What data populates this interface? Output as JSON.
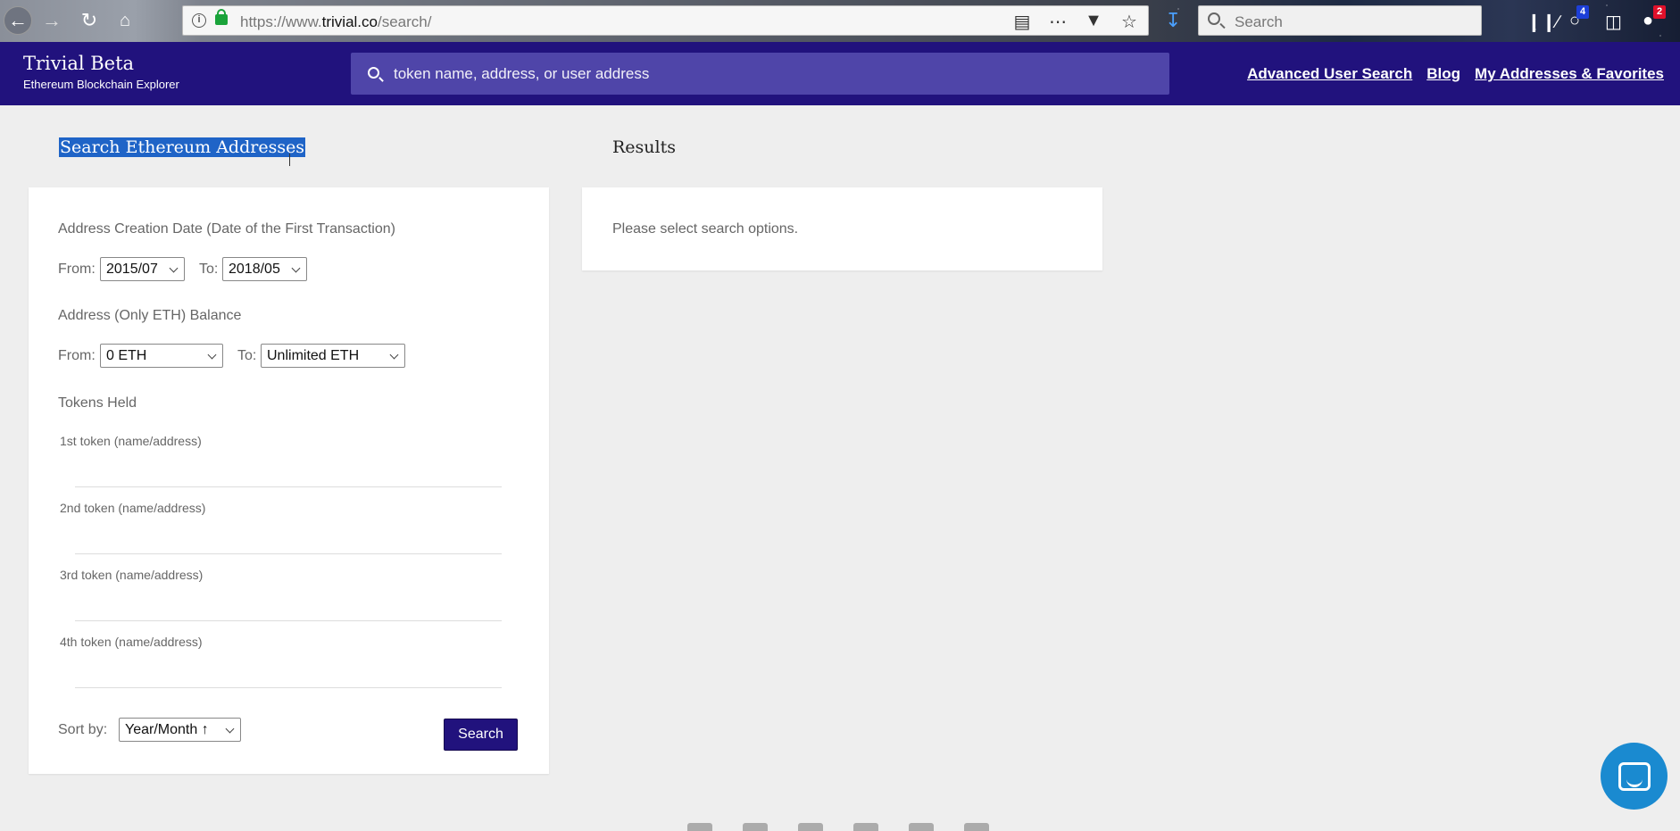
{
  "browser": {
    "url_prefix": "https://www.",
    "url_domain": "trivial.co",
    "url_path": "/search/",
    "search_placeholder": "Search",
    "badge_left": "4",
    "badge_right": "2"
  },
  "header": {
    "title": "Trivial Beta",
    "subtitle": "Ethereum Blockchain Explorer",
    "search_placeholder": "token name, address, or user address",
    "links": [
      "Advanced User Search",
      "Blog",
      "My Addresses & Favorites"
    ]
  },
  "form": {
    "heading": "Search Ethereum Addresses",
    "creation_date": {
      "label": "Address Creation Date (Date of the First Transaction)",
      "from_label": "From:",
      "from_value": "2015/07",
      "to_label": "To:",
      "to_value": "2018/05"
    },
    "balance": {
      "label": "Address (Only ETH) Balance",
      "from_label": "From:",
      "from_value": "0 ETH",
      "to_label": "To:",
      "to_value": "Unlimited ETH"
    },
    "tokens": {
      "label": "Tokens Held",
      "fields": [
        "1st token (name/address)",
        "2nd token (name/address)",
        "3rd token (name/address)",
        "4th token (name/address)"
      ]
    },
    "sort_label": "Sort by:",
    "sort_value": "Year/Month ↑",
    "search_button": "Search"
  },
  "results": {
    "heading": "Results",
    "message": "Please select search options."
  }
}
